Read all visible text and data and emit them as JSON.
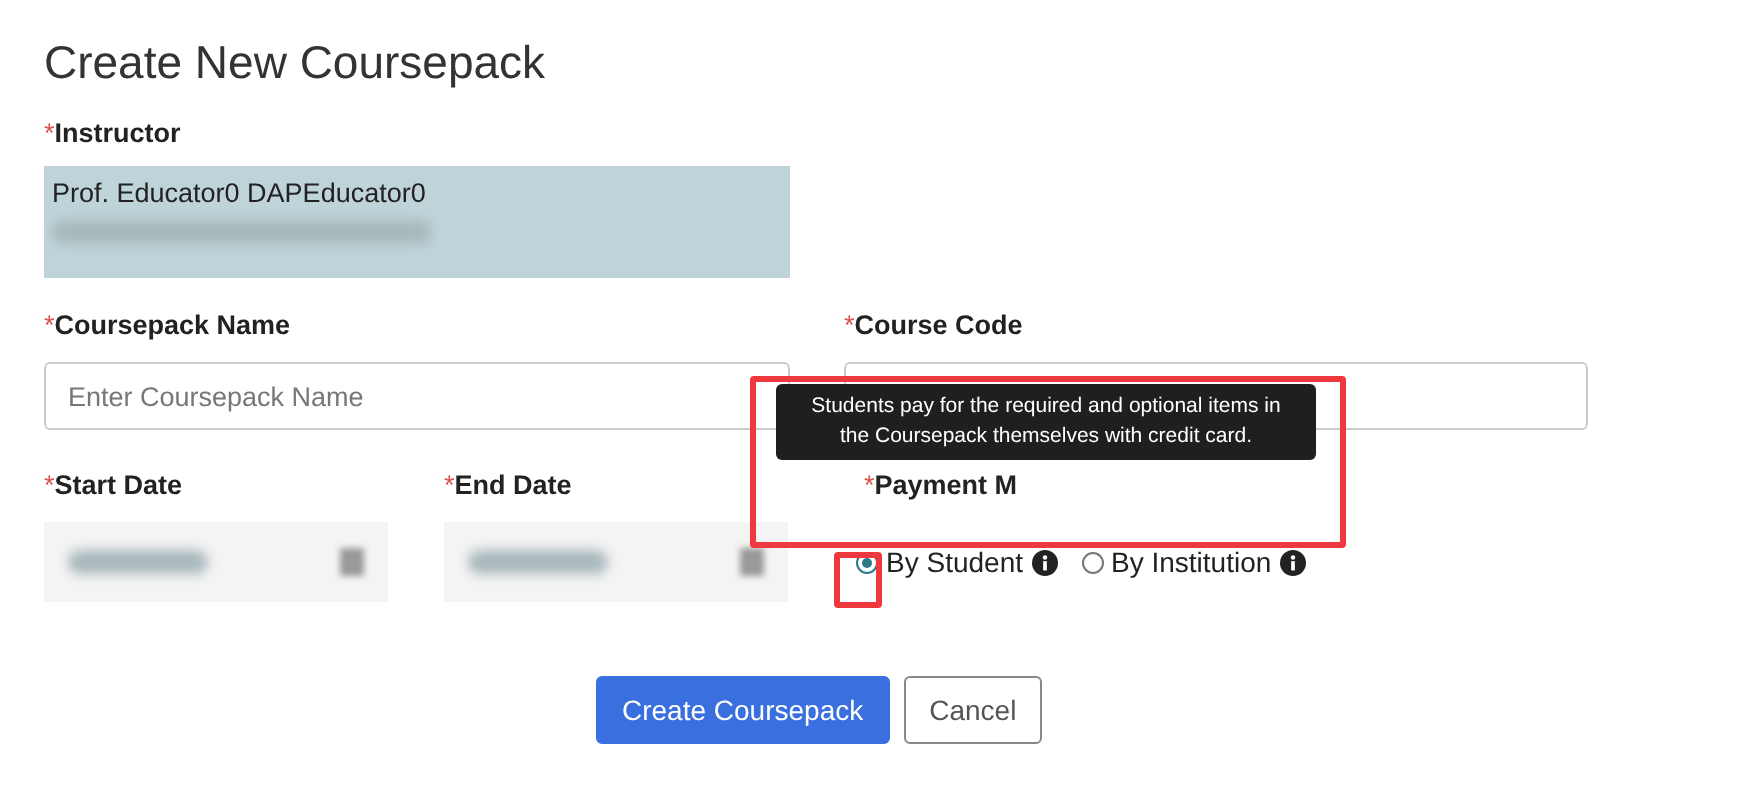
{
  "title": "Create New Coursepack",
  "instructor": {
    "marker": "*",
    "label": "Instructor",
    "name": "Prof. Educator0 DAPEducator0"
  },
  "coursepack_name": {
    "marker": "*",
    "label": "Coursepack Name",
    "placeholder": "Enter Coursepack Name"
  },
  "course_code": {
    "marker": "*",
    "label": "Course Code"
  },
  "start_date": {
    "marker": "*",
    "label": "Start Date"
  },
  "end_date": {
    "marker": "*",
    "label": "End Date"
  },
  "payment_method": {
    "marker": "*",
    "label": "Payment M",
    "options": [
      {
        "label": "By Student",
        "selected": true
      },
      {
        "label": "By Institution",
        "selected": false
      }
    ]
  },
  "tooltip": {
    "text": "Students pay for the required and optional items in the Coursepack themselves with credit card."
  },
  "buttons": [
    {
      "label": "Create Coursepack",
      "kind": "primary"
    },
    {
      "label": "Cancel",
      "kind": "secondary"
    }
  ]
}
